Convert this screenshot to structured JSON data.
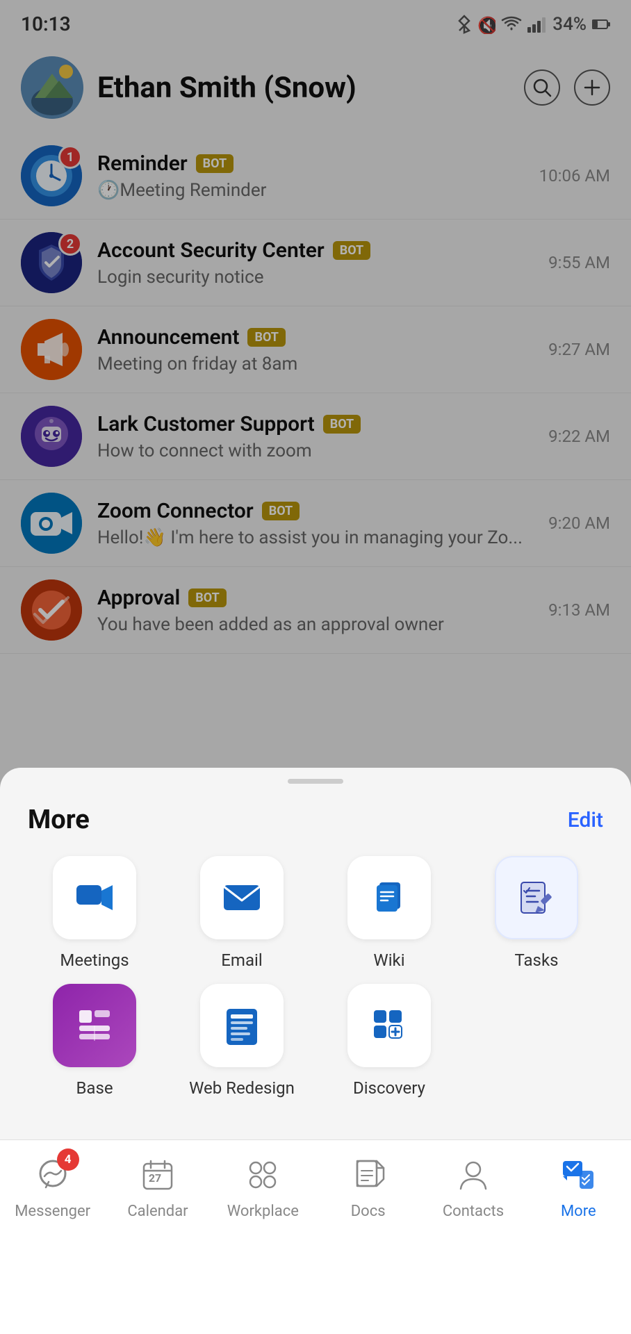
{
  "statusBar": {
    "time": "10:13",
    "batteryPercent": "34%"
  },
  "header": {
    "userName": "Ethan Smith (Snow)",
    "searchLabel": "search",
    "addLabel": "add"
  },
  "chats": [
    {
      "name": "Reminder",
      "isBot": true,
      "preview": "🕐Meeting Reminder",
      "time": "10:06 AM",
      "badge": "1",
      "avatarType": "reminder"
    },
    {
      "name": "Account Security Center",
      "isBot": true,
      "preview": "Login security notice",
      "time": "9:55 AM",
      "badge": "2",
      "avatarType": "security"
    },
    {
      "name": "Announcement",
      "isBot": true,
      "preview": "Meeting on friday at 8am",
      "time": "9:27 AM",
      "badge": "",
      "avatarType": "announcement"
    },
    {
      "name": "Lark Customer Support",
      "isBot": true,
      "preview": "How to connect with zoom",
      "time": "9:22 AM",
      "badge": "",
      "avatarType": "lark"
    },
    {
      "name": "Zoom Connector",
      "isBot": true,
      "preview": "Hello!👋 I'm here to assist you in managing your Zo...",
      "time": "9:20 AM",
      "badge": "",
      "avatarType": "zoom"
    },
    {
      "name": "Approval",
      "isBot": true,
      "preview": "You have been added as an approval owner",
      "time": "9:13 AM",
      "badge": "",
      "avatarType": "approval"
    }
  ],
  "bottomSheet": {
    "title": "More",
    "editLabel": "Edit"
  },
  "apps": [
    {
      "id": "meetings",
      "label": "Meetings"
    },
    {
      "id": "email",
      "label": "Email"
    },
    {
      "id": "wiki",
      "label": "Wiki"
    },
    {
      "id": "tasks",
      "label": "Tasks"
    },
    {
      "id": "base",
      "label": "Base"
    },
    {
      "id": "web-redesign",
      "label": "Web Redesign"
    },
    {
      "id": "discovery",
      "label": "Discovery"
    }
  ],
  "bottomNav": [
    {
      "id": "messenger",
      "label": "Messenger",
      "badge": "4",
      "active": false
    },
    {
      "id": "calendar",
      "label": "Calendar",
      "badge": "",
      "active": false
    },
    {
      "id": "workplace",
      "label": "Workplace",
      "badge": "",
      "active": false
    },
    {
      "id": "docs",
      "label": "Docs",
      "badge": "",
      "active": false
    },
    {
      "id": "contacts",
      "label": "Contacts",
      "badge": "",
      "active": false
    },
    {
      "id": "more",
      "label": "More",
      "badge": "",
      "active": true
    }
  ]
}
